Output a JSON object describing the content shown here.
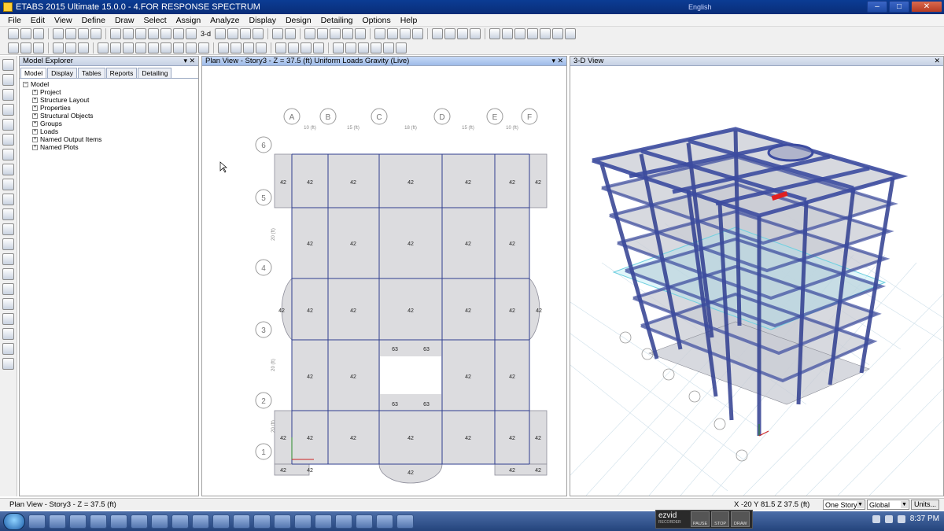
{
  "window": {
    "title": "ETABS 2015 Ultimate 15.0.0 - 4.FOR RESPONSE SPECTRUM",
    "lang_label": "English",
    "minimize": "–",
    "maximize": "□",
    "close": "✕"
  },
  "menu": [
    "File",
    "Edit",
    "View",
    "Define",
    "Draw",
    "Select",
    "Assign",
    "Analyze",
    "Display",
    "Design",
    "Detailing",
    "Options",
    "Help"
  ],
  "toolbar": {
    "view_3d_label": "3-d"
  },
  "explorer": {
    "title": "Model Explorer",
    "tabs": [
      "Model",
      "Display",
      "Tables",
      "Reports",
      "Detailing"
    ],
    "root": "Model",
    "items": [
      "Project",
      "Structure Layout",
      "Properties",
      "Structural Objects",
      "Groups",
      "Loads",
      "Named Output Items",
      "Named Plots"
    ]
  },
  "plan_view": {
    "title": "Plan View - Story3 - Z = 37.5 (ft)  Uniform Loads Gravity  (Live)",
    "grid_x_labels": [
      "A",
      "B",
      "C",
      "D",
      "E",
      "F"
    ],
    "grid_y_labels": [
      "6",
      "5",
      "4",
      "3",
      "2",
      "1"
    ],
    "dims_x": [
      "10 (ft)",
      "15 (ft)",
      "18 (ft)",
      "15 (ft)",
      "10 (ft)"
    ],
    "dims_y": [
      "20 (ft)",
      "20 (ft)",
      "20 (ft)"
    ],
    "load_value": "42",
    "opening_load_value": "63"
  },
  "view_3d": {
    "title": "3-D View"
  },
  "status": {
    "left_text": "Plan View - Story3 - Z = 37.5 (ft)",
    "coords": "X -20  Y 81.5  Z 37.5 (ft)",
    "story_option": "One Story",
    "coord_system": "Global",
    "units_button": "Units..."
  },
  "recorder": {
    "brand": "ezvid",
    "sub": "RECORDER",
    "buttons": [
      "PAUSE",
      "STOP",
      "DRAW"
    ]
  },
  "taskbar": {
    "clock": "8:37 PM"
  }
}
